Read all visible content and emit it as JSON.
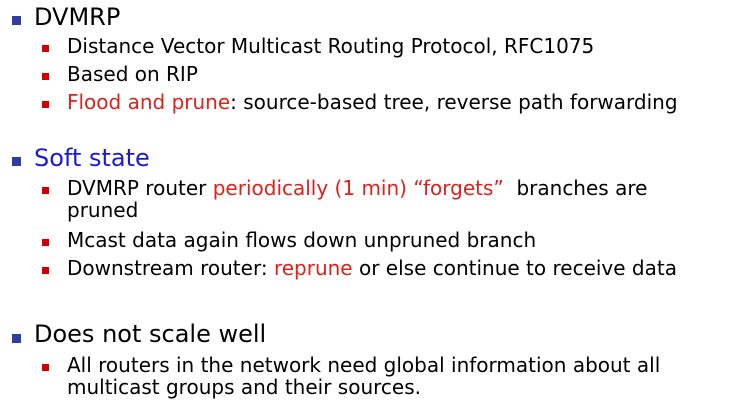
{
  "colors": {
    "level1_bullet": "#2f3da3",
    "level2_bullet": "#d00000",
    "highlight_red": "#e0201b",
    "highlight_blue": "#1a1ad0",
    "text": "#000000"
  },
  "sections": [
    {
      "heading": "DVMRP",
      "items": [
        {
          "parts": [
            "Distance Vector Multicast Routing Protocol, RFC1075"
          ]
        },
        {
          "parts": [
            "Based on RIP"
          ]
        },
        {
          "parts": [
            "Flood and prune",
            ": source-based tree, reverse path forwarding"
          ]
        }
      ]
    },
    {
      "heading": "Soft state",
      "items": [
        {
          "parts": [
            "DVMRP router ",
            "periodically (1 min) “forgets”",
            "  branches are",
            "pruned"
          ]
        },
        {
          "parts": [
            "Mcast data again flows down unpruned branch"
          ]
        },
        {
          "parts": [
            "Downstream router: ",
            "reprune",
            " or else continue to receive data"
          ]
        }
      ]
    },
    {
      "heading": "Does not scale well",
      "items": [
        {
          "parts": [
            "All routers in the network need global information about all",
            "multicast groups and their sources."
          ]
        }
      ]
    }
  ]
}
